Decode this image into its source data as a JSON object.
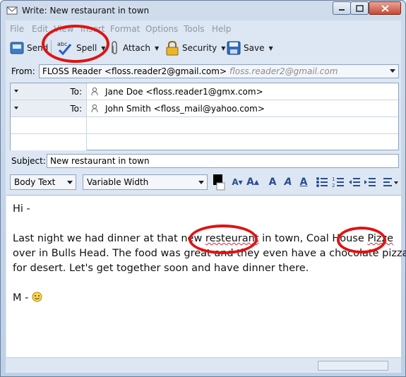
{
  "window": {
    "title": "Write: New restaurant in town"
  },
  "menu": [
    "File",
    "Edit",
    "View",
    "Insert",
    "Format",
    "Options",
    "Tools",
    "Help"
  ],
  "toolbar": {
    "send_label": "Send",
    "spell_label": "Spell",
    "attach_label": "Attach",
    "security_label": "Security",
    "save_label": "Save"
  },
  "from": {
    "label": "From:",
    "value": "FLOSS Reader <floss.reader2@gmail.com>",
    "identity": "floss.reader2@gmail.com"
  },
  "recipients": [
    {
      "type": "To:",
      "address": "Jane Doe <floss.reader1@gmx.com>"
    },
    {
      "type": "To:",
      "address": "John Smith <floss_mail@yahoo.com>"
    }
  ],
  "subject": {
    "label": "Subject:",
    "value": "New restaurant in town"
  },
  "format": {
    "paragraph_style": "Body Text",
    "font": "Variable Width"
  },
  "message": {
    "greeting": "Hi -",
    "line1_a": "Last night we had dinner at that new ",
    "misspelled_1": "resteurant",
    "line1_b": " in town, Coal House ",
    "misspelled_2": "Pizze",
    "line2": "over in Bulls Head. The food was great and they even have a chocolate pizza",
    "line3": "for desert. Let's get together soon and have dinner there.",
    "signoff": "M - "
  },
  "colors": {
    "annotation": "#e01313",
    "spell_error": "#d22233"
  }
}
